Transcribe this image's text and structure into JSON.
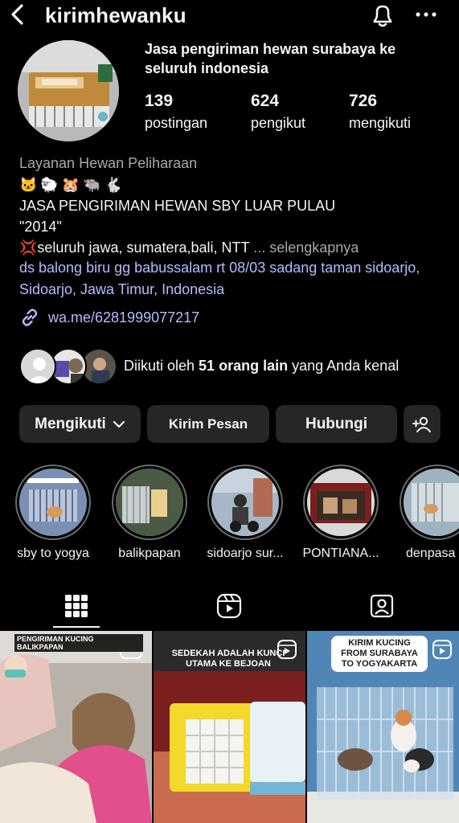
{
  "header": {
    "username": "kirimhewanku"
  },
  "profile": {
    "display_name": "Jasa pengiriman hewan surabaya ke seluruh indonesia",
    "stats": [
      {
        "value": "139",
        "label": "postingan"
      },
      {
        "value": "624",
        "label": "pengikut"
      },
      {
        "value": "726",
        "label": "mengikuti"
      }
    ],
    "category": "Layanan Hewan Peliharaan",
    "emojis": [
      "🐱",
      "🐑",
      "🐹",
      "🐃",
      "🐇"
    ],
    "bio_line1": "JASA PENGIRIMAN HEWAN SBY LUAR PULAU",
    "bio_line2": "\"2014\"",
    "bio_line3_mark": "💢",
    "bio_line3": "seluruh jawa, sumatera,bali, NTT",
    "bio_ellipsis": " ... ",
    "more_label": "selengkapnya",
    "address": "ds balong biru gg babussalam rt 08/03 sadang taman sidoarjo, Sidoarjo, Jawa Timur, Indonesia",
    "link": "wa.me/6281999077217"
  },
  "followed_by": {
    "prefix": "Diikuti oleh ",
    "bold": "51 orang lain",
    "suffix": " yang Anda kenal"
  },
  "buttons": {
    "following": "Mengikuti",
    "message": "Kirim Pesan",
    "contact": "Hubungi"
  },
  "highlights": [
    {
      "label": "sby to yogya"
    },
    {
      "label": "balikpapan"
    },
    {
      "label": "sidoarjo sur..."
    },
    {
      "label": "PONTIANA..."
    },
    {
      "label": "denpasa"
    }
  ],
  "posts": [
    {
      "caption": "PENGIRIMAN KUCING BALIKPAPAN"
    },
    {
      "caption": "SEDEKAH ADALAH KUNCI UTAMA KE BEJOAN"
    },
    {
      "caption": "KIRIM KUCING FROM SURABAYA TO YOGYAKARTA"
    }
  ],
  "colors": {
    "background": "#000000",
    "button": "#262626",
    "link": "#b3bcff",
    "muted": "#a8a8a8"
  }
}
